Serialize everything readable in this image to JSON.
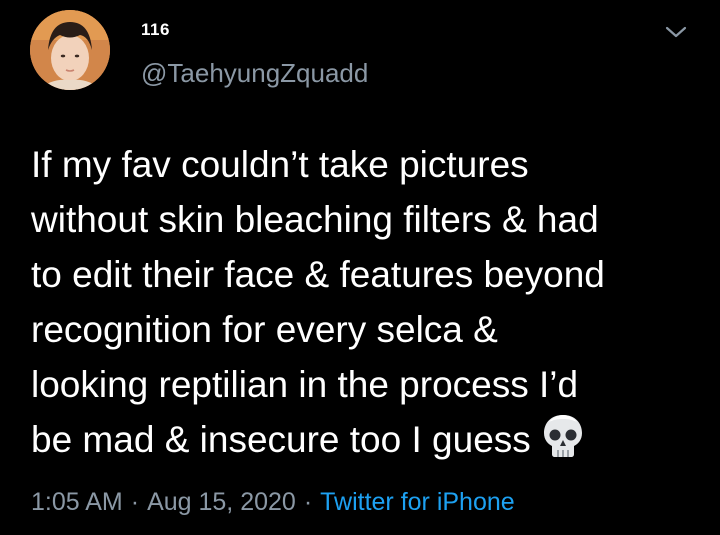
{
  "tweet": {
    "display_name": "116",
    "handle": "@TaehyungZquadd",
    "text": "If my fav couldn’t take pictures\nwithout skin bleaching filters & had\nto edit their face & features beyond\nrecognition for every selca &\nlooking  reptilian in the process I’d\nbe mad & insecure too I guess",
    "emoji_icon": "skull-icon",
    "time": "1:05 AM",
    "separator": "·",
    "date": "Aug 15, 2020",
    "source": "Twitter for iPhone"
  },
  "colors": {
    "background": "#000000",
    "text": "#ffffff",
    "muted": "#8b98a5",
    "link": "#1da1f2"
  },
  "icons": {
    "avatar": "avatar",
    "menu": "chevron-down-icon"
  }
}
